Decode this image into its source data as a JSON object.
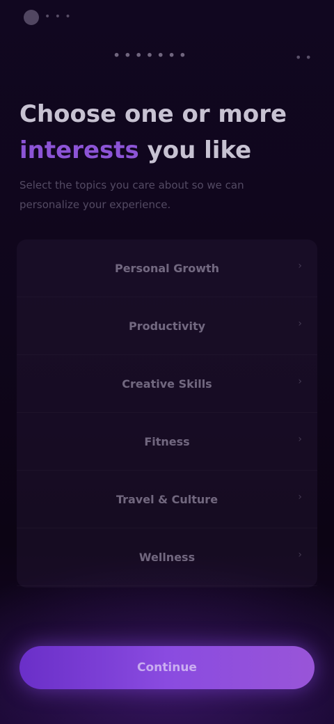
{
  "status_bar": {
    "logo_icon": "app-logo-icon",
    "text": "• • •"
  },
  "nav": {
    "title": "• • • • • • •",
    "action_icon": "more-icon",
    "action_glyph": "• •"
  },
  "headline": {
    "line1": "Choose one or more",
    "accent": "interests",
    "line2_rest": "you like"
  },
  "subtitle": "Select the topics you care about so we can personalize your experience.",
  "options": [
    {
      "label": "Personal Growth"
    },
    {
      "label": "Productivity"
    },
    {
      "label": "Creative Skills"
    },
    {
      "label": "Fitness"
    },
    {
      "label": "Travel & Culture"
    },
    {
      "label": "Wellness"
    }
  ],
  "option_chevron_icon": "chevron-right-icon",
  "cta": {
    "label": "Continue"
  },
  "colors": {
    "accent": "#8c54d6",
    "cta_gradient_start": "#6a2fc8",
    "cta_gradient_end": "#9955d8",
    "background": "#0c0414"
  }
}
